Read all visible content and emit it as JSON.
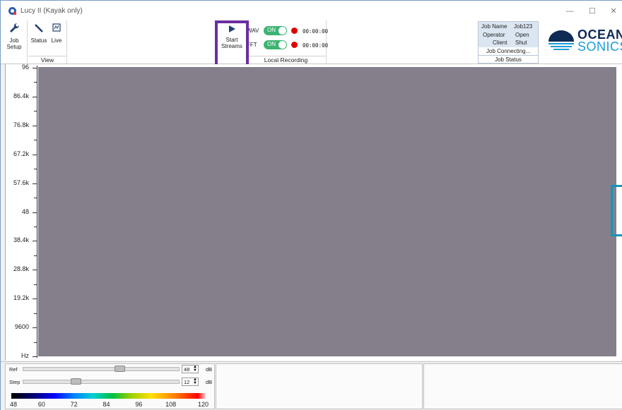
{
  "window": {
    "title": "Lucy II (Kayak only)",
    "controls": {
      "minimize": "—",
      "maximize": "☐",
      "close": "✕"
    }
  },
  "ribbon": {
    "job_setup_label": "Job Setup",
    "status_label": "Status",
    "live_label": "Live",
    "view_group_label": "View",
    "start_streams_label": "Start Streams",
    "local_recording_label": "Local Recording",
    "wav": {
      "label": "WAV",
      "toggle": "ON",
      "time": "00:00:00"
    },
    "fft": {
      "label": "FFT",
      "toggle": "ON",
      "time": "00:00:00"
    }
  },
  "job_status": {
    "group_label": "Job Status",
    "job_name_label": "Job Name",
    "job_name_value": "Job123",
    "operator_label": "Operator",
    "operator_value": "Open",
    "client_label": "Client",
    "client_value": "Shut",
    "connection": "Job Connecting..."
  },
  "logo": {
    "line1": "OCEAN",
    "line2": "SONICS"
  },
  "plot": {
    "y_tick_labels": [
      "96",
      "86.4k",
      "76.8k",
      "67.2k",
      "57.6k",
      "48",
      "38.4k",
      "28.8k",
      "19.2k",
      "9600",
      "Hz"
    ],
    "canvas_color": "#857f8c"
  },
  "controls": {
    "ref_label": "Ref",
    "ref_value": "48",
    "ref_unit": "dB",
    "step_label": "Step",
    "step_value": "12",
    "step_unit": "dB"
  },
  "colorbar": {
    "ticks": [
      "48",
      "60",
      "72",
      "84",
      "96",
      "108",
      "120"
    ]
  },
  "colors": {
    "accent_highlight": "#6a2fa0",
    "toggle_on": "#3cb371",
    "record_dot": "#e00000",
    "side_marker": "#1496b4"
  }
}
